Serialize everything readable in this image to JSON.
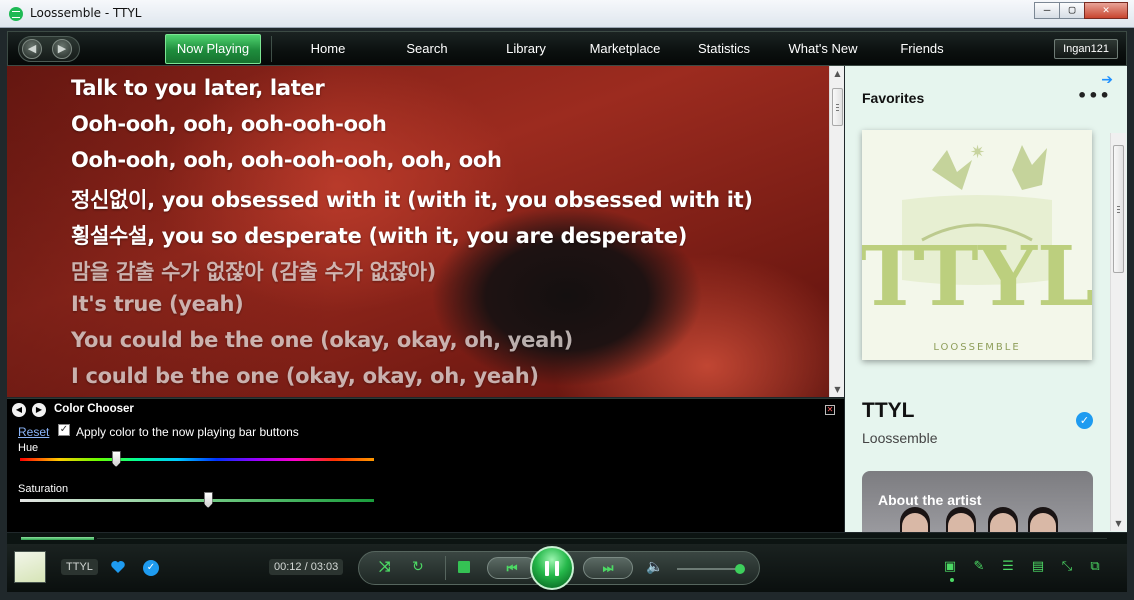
{
  "window": {
    "title": "Loossemble - TTYL",
    "min": "—",
    "max": "▢",
    "close": "✕"
  },
  "nav": {
    "back": "◀",
    "forward": "▶",
    "tabs": [
      "Now Playing",
      "Home",
      "Search",
      "Library",
      "Marketplace",
      "Statistics",
      "What's New",
      "Friends"
    ],
    "active_tab": "Now Playing",
    "user": "Ingan121"
  },
  "lyrics": {
    "lines": [
      "Talk to you later, later",
      "Ooh-ooh, ooh, ooh-ooh-ooh",
      "Ooh-ooh, ooh, ooh-ooh-ooh, ooh, ooh",
      "정신없이, you obsessed with it (with it, you obsessed with it)",
      "횡설수설, you so desperate (with it, you are desperate)",
      "맘을 감출 수가 없잖아 (감출 수가 없잖아)",
      "It's true (yeah)",
      "You could be the one (okay, okay, oh, yeah)",
      "I could be the one (okay, okay, oh, yeah)"
    ]
  },
  "color_chooser": {
    "title": "Color Chooser",
    "reset_label": "Reset",
    "checkbox_label": "Apply color to the now playing bar buttons",
    "checkbox_checked": true,
    "hue_label": "Hue",
    "hue_value": 0.27,
    "saturation_label": "Saturation",
    "saturation_value": 0.53
  },
  "favorites": {
    "title": "Favorites",
    "more": "•••",
    "track": "TTYL",
    "artist": "Loossemble",
    "about_label": "About the artist",
    "cover_text": "TTYL",
    "cover_brand": "LOOSSEMBLE"
  },
  "player": {
    "track_short": "TTYL",
    "time": "00:12 / 03:03",
    "progress": 0.066,
    "volume": 1.0,
    "accent": "#4cd964",
    "buttons": [
      "shuffle-icon",
      "repeat-icon",
      "stop-icon",
      "previous-icon",
      "pause-icon",
      "next-icon",
      "volume-icon"
    ],
    "right_icons": [
      "now-playing-view-icon",
      "pin-icon",
      "queue-icon",
      "lyrics-icon",
      "minimize-mode-icon",
      "external-window-icon"
    ]
  }
}
